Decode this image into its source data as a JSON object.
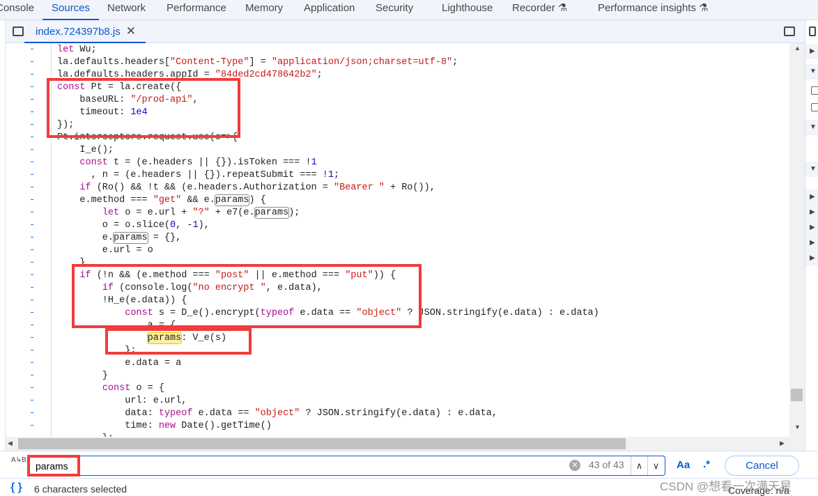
{
  "tabs": [
    {
      "label": "Console",
      "active": false
    },
    {
      "label": "Sources",
      "active": true
    },
    {
      "label": "Network",
      "active": false
    },
    {
      "label": "Performance",
      "active": false
    },
    {
      "label": "Memory",
      "active": false
    },
    {
      "label": "Application",
      "active": false
    },
    {
      "label": "Security",
      "active": false
    },
    {
      "label": "Lighthouse",
      "active": false
    },
    {
      "label": "Recorder ⚗",
      "active": false
    },
    {
      "label": "Performance insights ⚗",
      "active": false
    }
  ],
  "file_tab": {
    "name": "index.724397b8.js",
    "close": "✕"
  },
  "editor": {
    "gutter_marker": "-",
    "search_term": "params",
    "current_match_line": 24,
    "lines": [
      "let Wu;",
      "la.defaults.headers[\"Content-Type\"] = \"application/json;charset=utf-8\";",
      "la.defaults.headers.appId = \"84ded2cd478642b2\";",
      "const Pt = la.create({",
      "    baseURL: \"/prod-api\",",
      "    timeout: 1e4",
      "});",
      "Pt.interceptors.request.use(e=>{",
      "    I_e();",
      "    const t = (e.headers || {}).isToken === !1",
      "      , n = (e.headers || {}).repeatSubmit === !1;",
      "    if (Ro() && !t && (e.headers.Authorization = \"Bearer \" + Ro()),",
      "    e.method === \"get\" && e.params) {",
      "        let o = e.url + \"?\" + e7(e.params);",
      "        o = o.slice(0, -1),",
      "        e.params = {},",
      "        e.url = o",
      "    }",
      "    if (!n && (e.method === \"post\" || e.method === \"put\")) {",
      "        if (console.log(\"no encrypt \", e.data),",
      "        !H_e(e.data)) {",
      "            const s = D_e().encrypt(typeof e.data == \"object\" ? JSON.stringify(e.data) : e.data)",
      "              , a = {",
      "                params: V_e(s)",
      "            };",
      "            e.data = a",
      "        }",
      "        const o = {",
      "            url: e.url,",
      "            data: typeof e.data == \"object\" ? JSON.stringify(e.data) : e.data,",
      "            time: new Date().getTime()",
      "        };"
    ]
  },
  "search": {
    "value": "params",
    "count": "43 of 43",
    "case_label": "Aa",
    "regex_label": ".*",
    "cancel_label": "Cancel",
    "ab_icon": "A↳B"
  },
  "status": {
    "selection": "6 characters selected",
    "coverage": "Coverage: n/a"
  },
  "watermark": "CSDN @想看一次满天星",
  "colors": {
    "accent": "#0b57d0",
    "annotation": "#f23b3b",
    "keyword": "#aa0d91",
    "string": "#c41a16",
    "number": "#1c00cf"
  }
}
